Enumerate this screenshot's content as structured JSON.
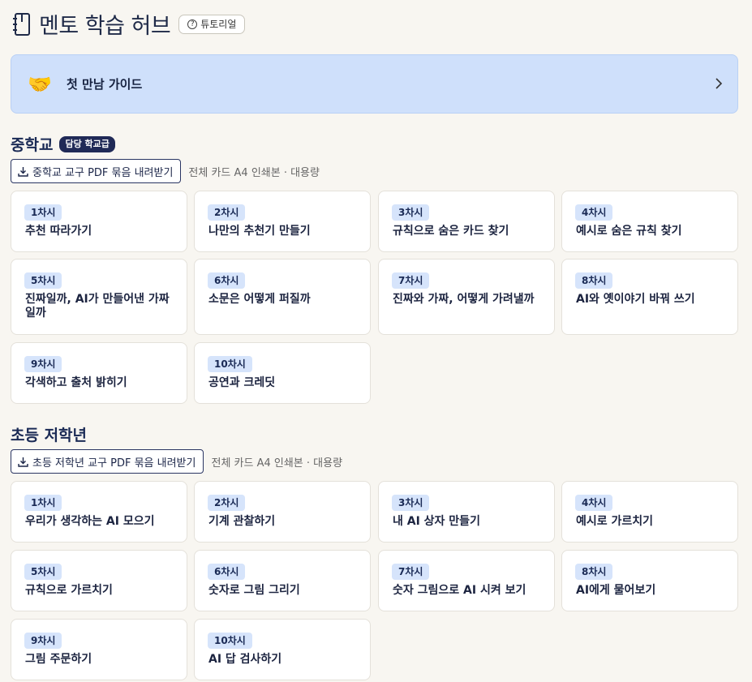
{
  "header": {
    "title": "멘토 학습 허브",
    "tutorial_label": "튜토리얼"
  },
  "guide": {
    "emoji": "🤝",
    "label": "첫 만남 가이드"
  },
  "sections": [
    {
      "title": "중학교",
      "badge": "담당 학교급",
      "download_label": "중학교 교구 PDF 묶음 내려받기",
      "note": "전체 카드 A4 인쇄본 · 대용량",
      "cards": [
        {
          "session": "1차시",
          "title": "추천 따라가기"
        },
        {
          "session": "2차시",
          "title": "나만의 추천기 만들기"
        },
        {
          "session": "3차시",
          "title": "규칙으로 숨은 카드 찾기"
        },
        {
          "session": "4차시",
          "title": "예시로 숨은 규칙 찾기"
        },
        {
          "session": "5차시",
          "title": "진짜일까, AI가 만들어낸 가짜일까"
        },
        {
          "session": "6차시",
          "title": "소문은 어떻게 퍼질까"
        },
        {
          "session": "7차시",
          "title": "진짜와 가짜, 어떻게 가려낼까"
        },
        {
          "session": "8차시",
          "title": "AI와 옛이야기 바꿔 쓰기"
        },
        {
          "session": "9차시",
          "title": "각색하고 출처 밝히기"
        },
        {
          "session": "10차시",
          "title": "공연과 크레딧"
        }
      ]
    },
    {
      "title": "초등 저학년",
      "download_label": "초등 저학년 교구 PDF 묶음 내려받기",
      "note": "전체 카드 A4 인쇄본 · 대용량",
      "cards": [
        {
          "session": "1차시",
          "title": "우리가 생각하는 AI 모으기"
        },
        {
          "session": "2차시",
          "title": "기계 관찰하기"
        },
        {
          "session": "3차시",
          "title": "내 AI 상자 만들기"
        },
        {
          "session": "4차시",
          "title": "예시로 가르치기"
        },
        {
          "session": "5차시",
          "title": "규칙으로 가르치기"
        },
        {
          "session": "6차시",
          "title": "숫자로 그림 그리기"
        },
        {
          "session": "7차시",
          "title": "숫자 그림으로 AI 시켜 보기"
        },
        {
          "session": "8차시",
          "title": "AI에게 물어보기"
        },
        {
          "session": "9차시",
          "title": "그림 주문하기"
        },
        {
          "session": "10차시",
          "title": "AI 답 검사하기"
        }
      ]
    }
  ]
}
